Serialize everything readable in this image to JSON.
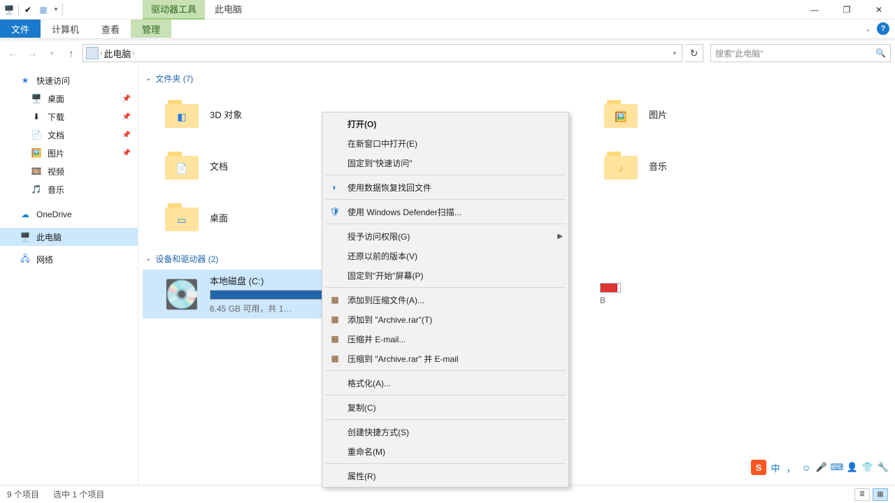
{
  "titlebar": {
    "tab_drive_tools": "驱动器工具",
    "tab_this_pc": "此电脑"
  },
  "ribbon": {
    "file": "文件",
    "computer": "计算机",
    "view": "查看",
    "manage": "管理"
  },
  "navrow": {
    "crumb": "此电脑",
    "search_placeholder": "搜索\"此电脑\""
  },
  "sidebar": {
    "quick_access": "快速访问",
    "desktop": "桌面",
    "downloads": "下载",
    "documents": "文档",
    "pictures": "图片",
    "videos": "视频",
    "music": "音乐",
    "onedrive": "OneDrive",
    "this_pc": "此电脑",
    "network": "网络"
  },
  "content": {
    "group_folders": "文件夹 (7)",
    "group_drives": "设备和驱动器 (2)",
    "items": {
      "objects3d": "3D 对象",
      "pictures": "图片",
      "documents": "文档",
      "music": "音乐",
      "desktop": "桌面"
    },
    "drive_c": {
      "name": "本地磁盘 (C:)",
      "sub": "6.45 GB 可用，共 1…",
      "fill_pct": 95
    },
    "drive_d": {
      "sub_suffix": "B",
      "fill_pct": 86
    }
  },
  "ctxmenu": {
    "open": "打开(O)",
    "open_new_window": "在新窗口中打开(E)",
    "pin_quick": "固定到\"快速访问\"",
    "recover": "使用数据恢复找回文件",
    "defender": "使用 Windows Defender扫描...",
    "grant_access": "授予访问权限(G)",
    "restore_version": "还原以前的版本(V)",
    "pin_start": "固定到\"开始\"屏幕(P)",
    "add_archive": "添加到压缩文件(A)...",
    "add_archive_rar": "添加到 \"Archive.rar\"(T)",
    "compress_email": "压缩并 E-mail...",
    "compress_rar_email": "压缩到 \"Archive.rar\" 并 E-mail",
    "format": "格式化(A)...",
    "copy": "复制(C)",
    "shortcut": "创建快捷方式(S)",
    "rename": "重命名(M)",
    "properties": "属性(R)"
  },
  "status": {
    "count": "9 个项目",
    "selected": "选中 1 个项目"
  },
  "ime": {
    "mode": "中"
  }
}
